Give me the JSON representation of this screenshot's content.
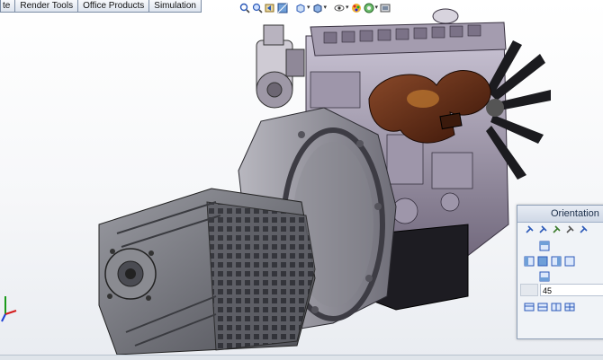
{
  "command_tabs": [
    "te",
    "Render Tools",
    "Office Products",
    "Simulation"
  ],
  "heads_up_toolbar": {
    "icons": [
      "zoom-to-fit-icon",
      "zoom-to-area-icon",
      "previous-view-icon",
      "section-view-icon",
      "view-orientation-icon",
      "display-style-icon",
      "hide-show-items-icon",
      "edit-appearance-icon",
      "apply-scene-icon",
      "view-settings-icon"
    ]
  },
  "orientation_dialog": {
    "title": "Orientation",
    "angle_value": "45"
  },
  "colors": {
    "tab_border": "#7a8ba3",
    "dialog_bg": "#f0f3f7",
    "engine_body": "#7a6f82",
    "manifold": "#5a2a18",
    "transmission": "#77787d"
  }
}
